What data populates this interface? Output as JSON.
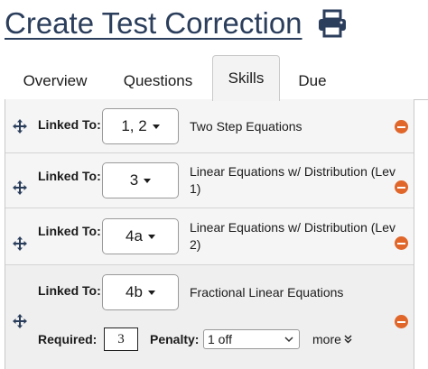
{
  "page": {
    "title": "Create Test Correction",
    "print_icon": "printer-icon"
  },
  "tabs": [
    {
      "label": "Overview",
      "active": false
    },
    {
      "label": "Questions",
      "active": false
    },
    {
      "label": "Skills",
      "active": true
    },
    {
      "label": "Due",
      "active": false
    }
  ],
  "skills": [
    {
      "linked_label": "Linked To:",
      "questions": "1, 2",
      "name": "Two Step Equations"
    },
    {
      "linked_label": "Linked To:",
      "questions": "3",
      "name": "Linear Equations w/ Distribution (Lev 1)"
    },
    {
      "linked_label": "Linked To:",
      "questions": "4a",
      "name": "Linear Equations w/ Distribution (Lev 2)"
    },
    {
      "linked_label": "Linked To:",
      "questions": "4b",
      "name": "Fractional Linear Equations"
    }
  ],
  "options": {
    "required_label": "Required:",
    "required_value": "3",
    "penalty_label": "Penalty:",
    "penalty_value": "1 off",
    "more_label": "more"
  },
  "colors": {
    "title": "#2b3e5c",
    "remove": "#e0662a",
    "row_bg": "#f5f5f5"
  }
}
